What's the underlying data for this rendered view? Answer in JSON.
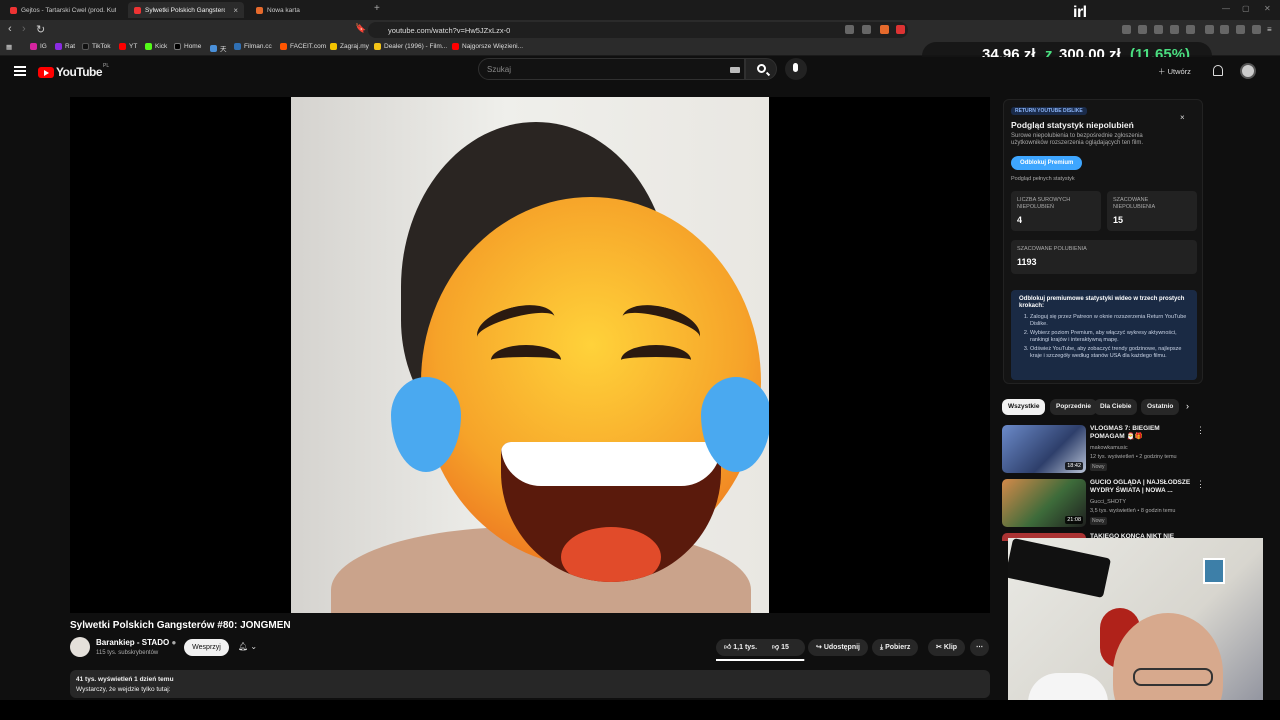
{
  "browser": {
    "tabs": [
      {
        "label": "Gejtos - Tartarski Cwel (prod. Kutas ?",
        "active": false
      },
      {
        "label": "Sylwetki Polskich Gangsterów",
        "active": true
      },
      {
        "label": "Nowa karta",
        "active": false
      }
    ],
    "url": "youtube.com/watch?v=Hw5JZxLzx-0",
    "bookmarks": [
      "IG",
      "Rat",
      "TikTok",
      "YT",
      "Kick",
      "Home",
      "天",
      "Filman.cc",
      "FACEIT.com",
      "Zagraj.my",
      "Dealer (1996) - Film...",
      "Najgorsze Więzieni..."
    ],
    "overlay_logo": "irl"
  },
  "donation": {
    "current": "34,96 zł",
    "sep": "z",
    "goal": "300,00 zł",
    "percent": "(11.65%)",
    "progress": 0.1165
  },
  "yt": {
    "logo_text": "YouTube",
    "region": "PL",
    "search_placeholder": "Szukaj",
    "create_label": "Utwórz"
  },
  "video": {
    "title": "Sylwetki Polskich Gangsterów #80: JONGMEN",
    "channel": "Barankiep - STADO",
    "subscribers": "115 tys. subskrybentów",
    "support_label": "Wesprzyj",
    "likes": "1,1 tys.",
    "dislikes": "15",
    "like_ratio": 0.987,
    "share_label": "Udostępnij",
    "download_label": "Pobierz",
    "clip_label": "Klip",
    "views_line": "41 tys. wyświetleń  1 dzień temu",
    "desc_line": "Wystarczy, że wejdzie tylko tutaj:"
  },
  "ryd": {
    "badge": "RETURN YOUTUBE DISLIKE",
    "title": "Podgląd statystyk niepolubień",
    "subtitle": "Surowe niepolubienia to bezpośrednie zgłoszenia użytkowników rozszerzenia oglądających ten film.",
    "button": "Odblokuj Premium",
    "link": "Podgląd pełnych statystyk",
    "raw_label": "LICZBA SUROWYCH NIEPOLUBIEŃ",
    "raw_value": "4",
    "est_dislikes_label": "SZACOWANE NIEPOLUBIENIA",
    "est_dislikes_value": "15",
    "est_likes_label": "SZACOWANE POLUBIENIA",
    "est_likes_value": "1193",
    "info_title": "Odblokuj premiumowe statystyki wideo w trzech prostych krokach:",
    "steps": [
      "Zaloguj się przez Patreon w oknie rozszerzenia Return YouTube Dislike.",
      "Wybierz poziom Premium, aby włączyć wykresy aktywności, rankingi krajów i interaktywną mapę.",
      "Odśwież YouTube, aby zobaczyć trendy godzinowe, najlepsze kraje i szczegóły według stanów USA dla każdego filmu."
    ]
  },
  "chips": [
    "Wszystkie",
    "Poprzednie",
    "Dla Ciebie",
    "Ostatnio"
  ],
  "recs": [
    {
      "title": "VLOGMAS 7: BIEGIEM POMAGAM 🎅🎁",
      "channel": "makowkamusic",
      "meta": "12 tys. wyświetleń • 2 godziny temu",
      "badge": "Nowy",
      "duration": "18:42"
    },
    {
      "title": "GUCIO OGLĄDA | NAJSŁODSZE WYDRY ŚWIATA | NOWA ...",
      "channel": "Gucci_SHOTY",
      "meta": "3,5 tys. wyświetleń • 8 godzin temu",
      "badge": "Nowy",
      "duration": "21:08"
    },
    {
      "title": "TAKIEGO KOŃCA NIKT NIE",
      "channel": "",
      "meta": "",
      "badge": "",
      "duration": ""
    }
  ]
}
